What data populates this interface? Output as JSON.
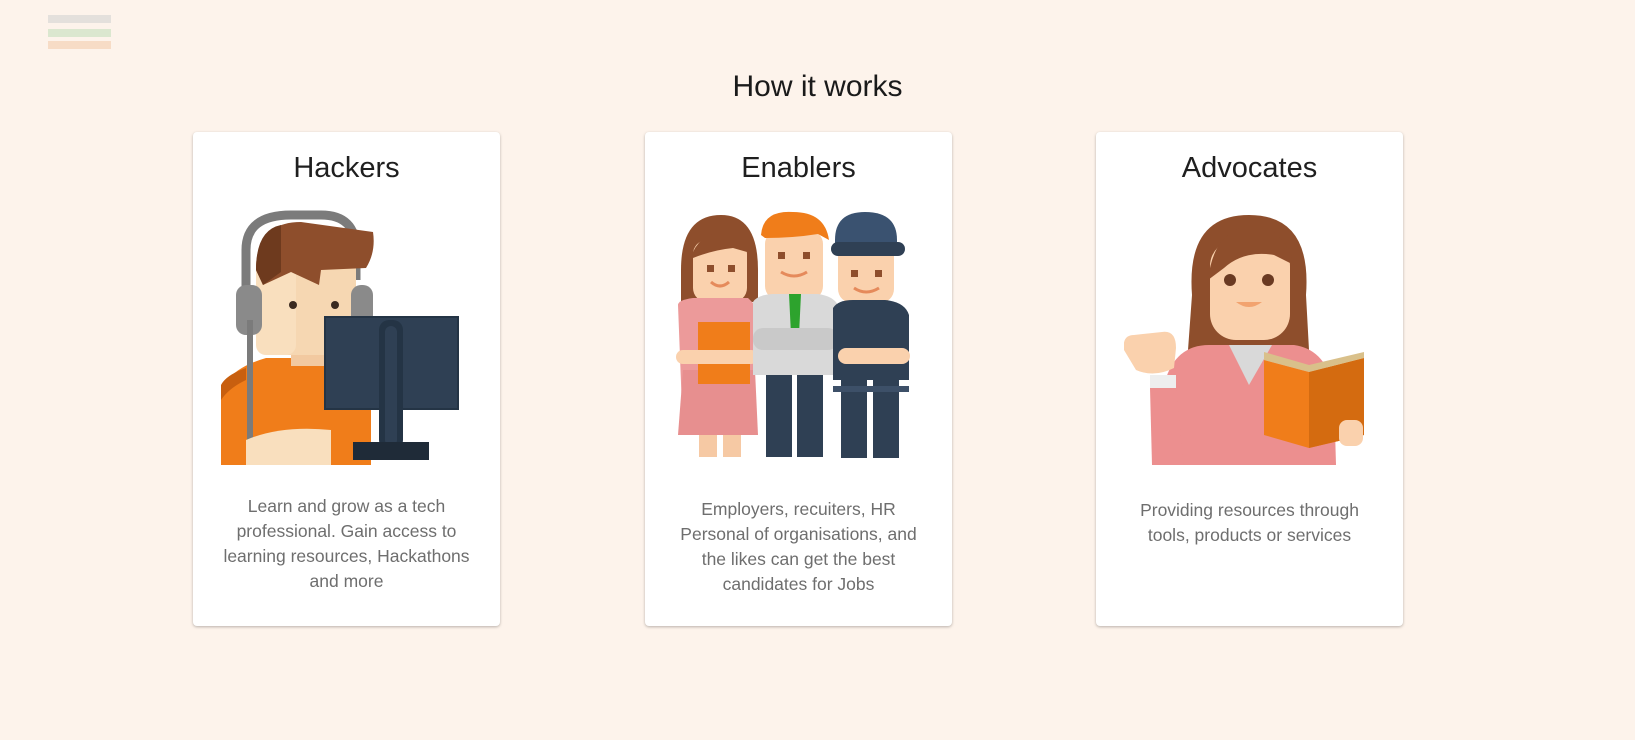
{
  "menu": {
    "icon": "hamburger-menu-icon"
  },
  "section": {
    "title": "How it works"
  },
  "cards": [
    {
      "title": "Hackers",
      "illustration": "hacker-with-headset-at-computer",
      "description": "Learn and grow as a tech professional. Gain access to learning resources, Hackathons and more"
    },
    {
      "title": "Enablers",
      "illustration": "group-of-three-professionals",
      "description": "Employers, recuiters, HR Personal of organisations, and the likes can get the best candidates for Jobs"
    },
    {
      "title": "Advocates",
      "illustration": "woman-presenting-with-book",
      "description": "Providing resources through tools, products or services"
    }
  ],
  "colors": {
    "background": "#fdf3eb",
    "card": "#ffffff",
    "accent_orange": "#f07d1a",
    "hair_brown": "#8e4e2c",
    "navy": "#2f4054"
  }
}
